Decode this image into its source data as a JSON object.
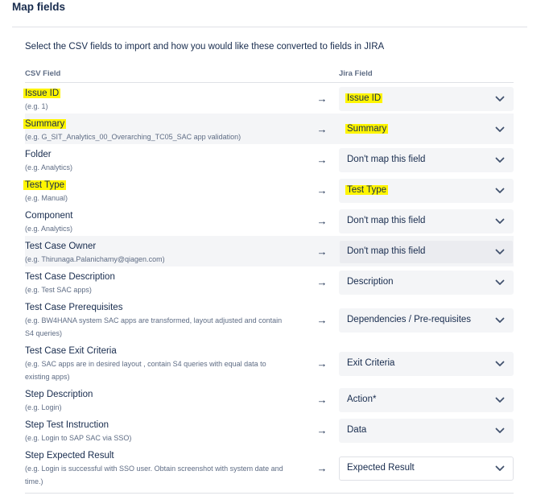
{
  "page": {
    "title": "Map fields",
    "intro": "Select the CSV fields to import and how you would like these converted to fields in JIRA"
  },
  "columns": {
    "csv": "CSV Field",
    "jira": "Jira Field"
  },
  "arrow_glyph": "→",
  "icons": {
    "select_chevron": "chevron-down-icon",
    "arrow": "arrow-right-icon"
  },
  "colors": {
    "highlight": "#fff500",
    "text": "#172b4d",
    "muted": "#5e6c84"
  },
  "rows": [
    {
      "name": "Issue ID",
      "example": "(e.g. 1)",
      "mapped": "Issue ID",
      "highlighted": true
    },
    {
      "name": "Summary",
      "example": "(e.g. G_SIT_Analytics_00_Overarching_TC05_SAC app validation)",
      "mapped": "Summary",
      "highlighted": true
    },
    {
      "name": "Folder",
      "example": "(e.g. Analytics)",
      "mapped": "Don't map this field",
      "highlighted": false
    },
    {
      "name": "Test Type",
      "example": "(e.g. Manual)",
      "mapped": "Test Type",
      "highlighted": true
    },
    {
      "name": "Component",
      "example": "(e.g. Analytics)",
      "mapped": "Don't map this field",
      "highlighted": false
    },
    {
      "name": "Test Case Owner",
      "example": "(e.g. Thirunaga.Palanichamy@qiagen.com)",
      "mapped": "Don't map this field",
      "highlighted": false
    },
    {
      "name": "Test Case Description",
      "example": "(e.g. Test SAC apps)",
      "mapped": "Description",
      "highlighted": false
    },
    {
      "name": "Test Case Prerequisites",
      "example": "(e.g. BW4HANA system SAC apps are transformed, layout adjusted and contain S4 queries)",
      "mapped": "Dependencies / Pre-requisites",
      "highlighted": false
    },
    {
      "name": "Test Case Exit Criteria",
      "example": "(e.g. SAC apps are in desired layout , contain S4 queries with equal data to existing apps)",
      "mapped": "Exit Criteria",
      "highlighted": false
    },
    {
      "name": "Step Description",
      "example": "(e.g. Login)",
      "mapped": "Action*",
      "highlighted": false
    },
    {
      "name": "Step Test Instruction",
      "example": "(e.g. Login to SAP SAC via SSO)",
      "mapped": "Data",
      "highlighted": false
    },
    {
      "name": "Step Expected Result",
      "example": "(e.g. Login is successful with SSO user. Obtain screenshot with system date and time.)",
      "mapped": "Expected Result",
      "highlighted": false
    }
  ]
}
